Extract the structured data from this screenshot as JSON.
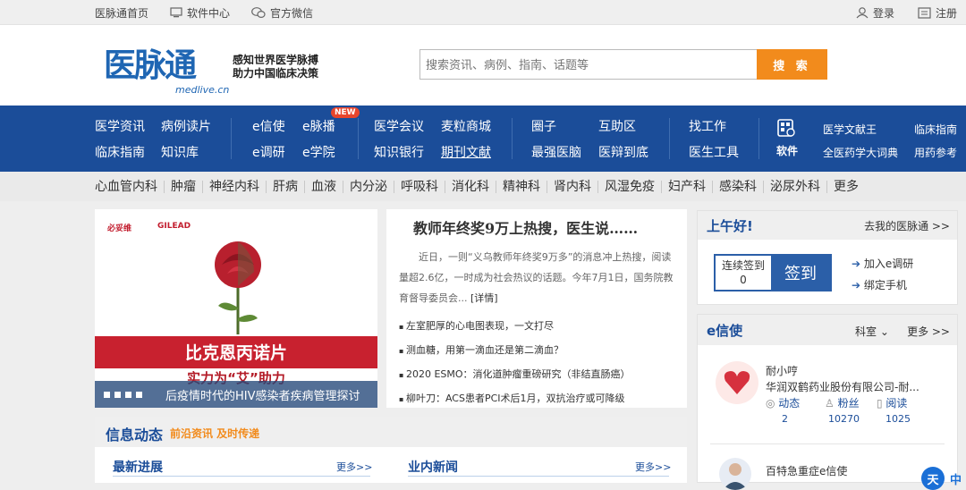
{
  "topbar": {
    "home": "医脉通首页",
    "software": "软件中心",
    "wechat": "官方微信",
    "login": "登录",
    "register": "注册"
  },
  "header": {
    "logo": "医脉通",
    "domain": "medlive.cn",
    "slogan1": "感知世界医学脉搏",
    "slogan2": "助力中国临床决策",
    "search_placeholder": "搜索资讯、病例、指南、话题等",
    "search_button": "搜 索"
  },
  "nav": {
    "r1": [
      "医学资讯",
      "病例读片",
      "e信使",
      "e脉播",
      "医学会议",
      "麦粒商城",
      "圈子",
      "互助区",
      "找工作"
    ],
    "r2": [
      "临床指南",
      "知识库",
      "e调研",
      "e学院",
      "知识银行",
      "期刊文献",
      "最强医脑",
      "医辩到底",
      "医生工具"
    ],
    "new_badge": "NEW",
    "software": "软件",
    "tools": [
      "医学文献王",
      "临床指南",
      "全医药学大词典",
      "用药参考"
    ]
  },
  "categories": [
    "心血管内科",
    "肿瘤",
    "神经内科",
    "肝病",
    "血液",
    "内分泌",
    "呼吸科",
    "消化科",
    "精神科",
    "肾内科",
    "风湿免疫",
    "妇产科",
    "感染科",
    "泌尿外科",
    "更多"
  ],
  "banner": {
    "brand1": "必妥维",
    "brand2": "GILEAD",
    "headline": "比克恩丙诺片",
    "tagline": "实力为“艾”助力",
    "caption": "后疫情时代的HIV感染者疾病管理探讨"
  },
  "news": {
    "title": "教师年终奖9万上热搜，医生说……",
    "summary": "近日，一则“义乌教师年终奖9万多”的消息冲上热搜，阅读量超2.6亿，一时成为社会热议的话题。今年7月1日，国务院教育督导委员会...",
    "detail": "[详情]",
    "items": [
      "左室肥厚的心电图表现，一文打尽",
      "测血糖，用第一滴血还是第二滴血？",
      "2020 ESMO：消化道肿瘤重磅研究（非结直肠癌）",
      "柳叶刀：ACS患者PCI术后1月，双抗治疗或可降级"
    ]
  },
  "info": {
    "title": "信息动态",
    "sub": "前沿资讯  及时传递",
    "col1": "最新进展",
    "col2": "业内新闻",
    "more": "更多>>"
  },
  "greeting": {
    "title": "上午好!",
    "link": "去我的医脉通 >>",
    "sign_label": "连续签到",
    "sign_count": "0",
    "sign_button": "签到",
    "links": [
      "加入e调研",
      "绑定手机"
    ]
  },
  "emessenger": {
    "title": "e信使",
    "dept": "科室",
    "more": "更多 >>",
    "user1_name": "耐小哼",
    "user1_company": "华润双鹤药业股份有限公司-耐...",
    "stats": [
      "动态",
      "粉丝",
      "阅读"
    ],
    "values": [
      "2",
      "10270",
      "1025"
    ],
    "user2_name": "百特急重症e信使"
  },
  "float": {
    "a": "天",
    "b": "中"
  }
}
